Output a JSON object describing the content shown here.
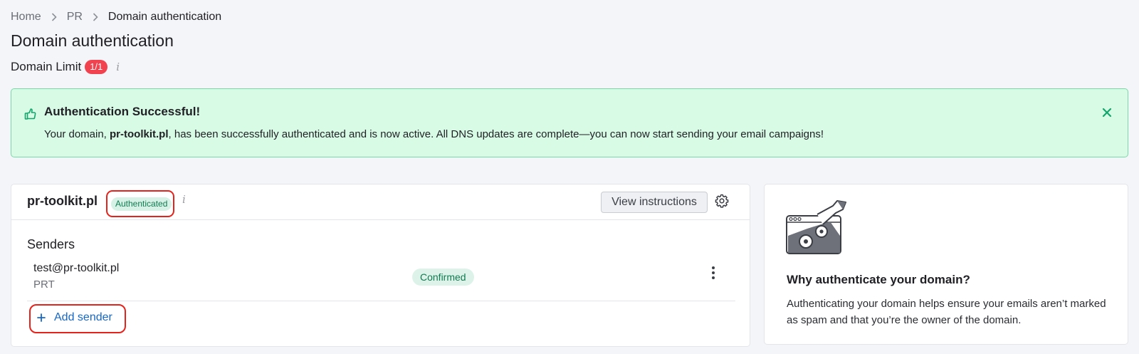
{
  "breadcrumb": {
    "items": [
      "Home",
      "PR"
    ],
    "current": "Domain authentication"
  },
  "page": {
    "title": "Domain authentication",
    "limit_label": "Domain Limit",
    "limit_value": "1/1",
    "info_glyph": "i"
  },
  "alert": {
    "title": "Authentication Successful!",
    "msg_before": "Your domain, ",
    "msg_domain": "pr-toolkit.pl",
    "msg_after": ", has been successfully authenticated and is now active. All DNS updates are complete—you can now start sending your email campaigns!",
    "icon": "thumbs-up-icon"
  },
  "domain_card": {
    "domain": "pr-toolkit.pl",
    "status": "Authenticated",
    "view_instructions_label": "View instructions",
    "senders_title": "Senders",
    "senders": [
      {
        "email": "test@pr-toolkit.pl",
        "name": "PRT",
        "status": "Confirmed"
      }
    ],
    "add_sender_label": "Add sender"
  },
  "info_card": {
    "title": "Why authenticate your domain?",
    "text": "Authenticating your domain helps ensure your emails aren’t marked as spam and that you’re the owner of the domain."
  },
  "colors": {
    "accent": "#1767c8",
    "success_bg": "#d8fbe6",
    "badge_red": "#f0434f",
    "highlight": "#e4241c"
  }
}
